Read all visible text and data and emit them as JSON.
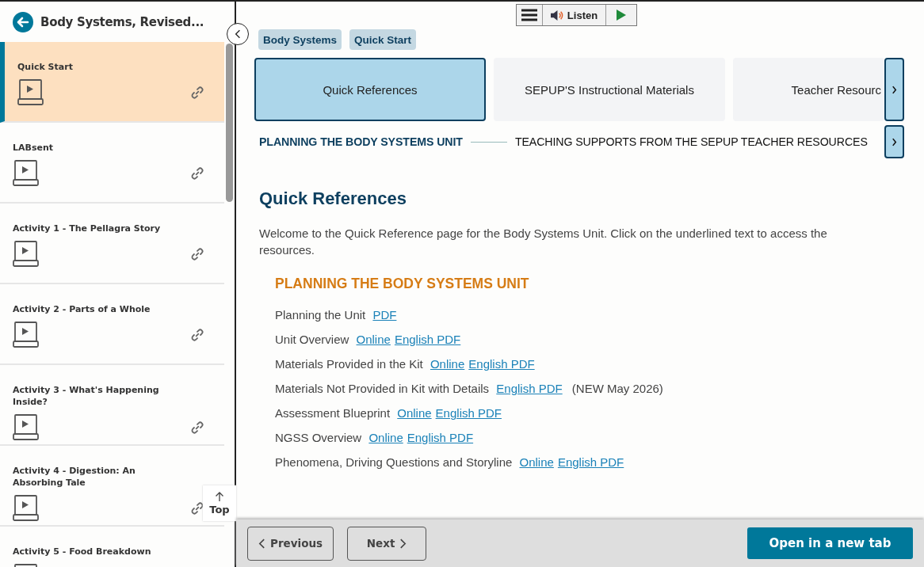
{
  "sidebar": {
    "title": "Body Systems, Revised...",
    "items": [
      {
        "title": "Quick Start",
        "selected": true
      },
      {
        "title": "LABsent",
        "selected": false
      },
      {
        "title": "Activity 1 - The Pellagra Story",
        "selected": false
      },
      {
        "title": "Activity 2 - Parts of a Whole",
        "selected": false
      },
      {
        "title": "Activity 3 - What's Happening Inside?",
        "selected": false
      },
      {
        "title": "Activity 4 - Digestion: An Absorbing Tale",
        "selected": false
      },
      {
        "title": "Activity 5 - Food Breakdown",
        "selected": false
      }
    ],
    "top_button": "Top"
  },
  "toolbar": {
    "listen": "Listen"
  },
  "breadcrumbs": [
    "Body Systems",
    "Quick Start"
  ],
  "tabs": [
    {
      "label": "Quick References",
      "selected": true
    },
    {
      "label": "SEPUP'S Instructional Materials",
      "selected": false
    },
    {
      "label": "Teacher Resourc",
      "selected": false
    }
  ],
  "sections": [
    {
      "label": "PLANNING THE BODY SYSTEMS UNIT",
      "selected": true
    },
    {
      "label": "TEACHING SUPPORTS FROM THE SEPUP TEACHER RESOURCES",
      "selected": false
    }
  ],
  "content": {
    "heading": "Quick References",
    "intro": "Welcome to the Quick Reference page for the Body Systems Unit. Click on the underlined text to access the resources.",
    "subheading": "PLANNING THE BODY SYSTEMS UNIT",
    "resources": [
      {
        "label": "Planning the Unit",
        "links": [
          "PDF"
        ]
      },
      {
        "label": "Unit Overview",
        "links": [
          "Online",
          "English PDF"
        ]
      },
      {
        "label": "Materials Provided in the Kit",
        "links": [
          "Online",
          "English PDF"
        ]
      },
      {
        "label": "Materials Not Provided in Kit with Details",
        "links": [
          "English PDF"
        ],
        "note": "(NEW May 2026)"
      },
      {
        "label": "Assessment Blueprint",
        "links": [
          "Online",
          "English PDF"
        ]
      },
      {
        "label": "NGSS Overview",
        "links": [
          "Online",
          "English PDF"
        ]
      },
      {
        "label": "Phenomena, Driving Questions and Storyline",
        "links": [
          "Online",
          "English PDF"
        ]
      }
    ]
  },
  "footer": {
    "previous": "Previous",
    "next": "Next",
    "open": "Open in a new tab"
  }
}
